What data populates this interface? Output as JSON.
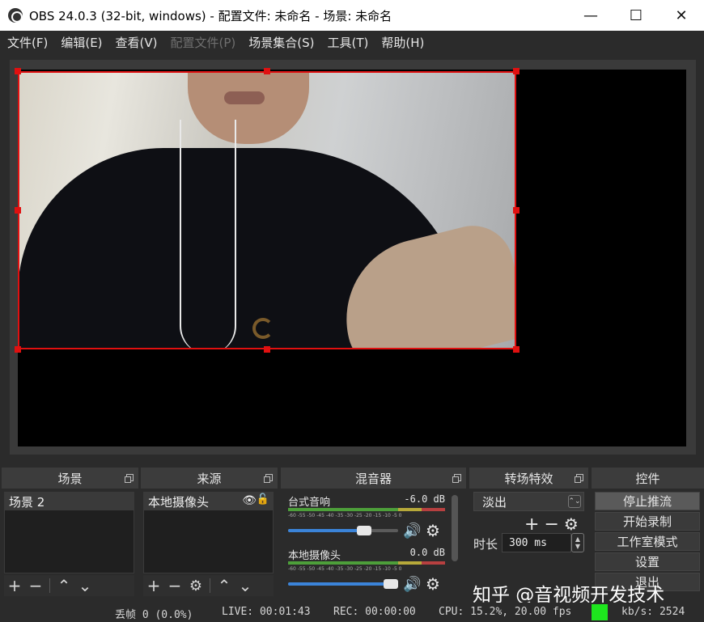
{
  "window": {
    "title": "OBS 24.0.3 (32-bit, windows) - 配置文件: 未命名 - 场景: 未命名",
    "minimize_glyph": "—",
    "maximize_glyph": "☐",
    "close_glyph": "✕"
  },
  "menu": [
    {
      "label": "文件(F)",
      "enabled": true
    },
    {
      "label": "编辑(E)",
      "enabled": true
    },
    {
      "label": "查看(V)",
      "enabled": true
    },
    {
      "label": "配置文件(P)",
      "enabled": false
    },
    {
      "label": "场景集合(S)",
      "enabled": true
    },
    {
      "label": "工具(T)",
      "enabled": true
    },
    {
      "label": "帮助(H)",
      "enabled": true
    }
  ],
  "docks": {
    "scenes": {
      "title": "场景",
      "items": [
        "场景 2"
      ]
    },
    "sources": {
      "title": "来源",
      "items": [
        {
          "name": "本地摄像头",
          "visible_icon": "eye-icon",
          "lock_icon": "lock-icon"
        }
      ]
    },
    "mixer": {
      "title": "混音器",
      "channels": [
        {
          "name": "台式音响",
          "db": "-6.0 dB",
          "volume": 0.72
        },
        {
          "name": "本地摄像头",
          "db": "0.0 dB",
          "volume": 1.0
        }
      ],
      "tick_labels": "-60 -55 -50 -45 -40 -35 -30 -25 -20 -15 -10 -5 0"
    },
    "transitions": {
      "title": "转场特效",
      "selected": "淡出",
      "duration_label": "时长",
      "duration_value": "300 ms"
    },
    "controls": {
      "title": "控件",
      "buttons": [
        "停止推流",
        "开始录制",
        "工作室模式",
        "设置",
        "退出"
      ]
    }
  },
  "status": {
    "dropped_frames": "丢帧 0 (0.0%)",
    "live": "LIVE: 00:01:43",
    "rec": "REC: 00:00:00",
    "cpu": "CPU: 15.2%, 20.00 fps",
    "kbps": "kb/s: 2524",
    "indicator_color": "#1ee61e"
  },
  "watermark": "知乎 @音视频开发技术",
  "colors": {
    "selection": "#e01010",
    "slider_fill": "#3b84d9",
    "background": "#2b2b2b"
  }
}
